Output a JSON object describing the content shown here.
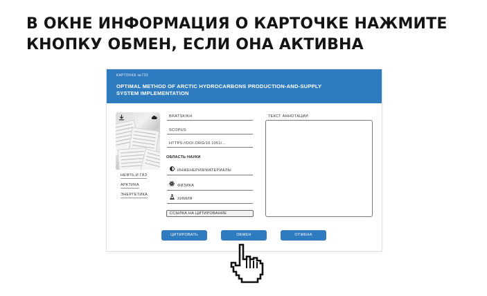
{
  "instruction": {
    "line1": "В ОКНЕ ИНФОРМАЦИЯ О КАРТОЧКЕ НАЖМИТЕ",
    "line2": "КНОПКУ ОБМЕН, ЕСЛИ ОНА АКТИВНА"
  },
  "card": {
    "number": "КАРТОЧКА №733",
    "title_line1": "OPTIMAL METHOD OF ARCTIC HYDROCARBONS PRODUCTION-AND-SUPPLY",
    "title_line2": "SYSTEM IMPLEMENTATION",
    "thumbnail": {
      "download_icon": "download-icon",
      "cloud_icon": "cloud-icon"
    },
    "tags": [
      "НЕФТЬ И ГАЗ",
      "АРКТИКА",
      "ЭНЕРГЕТИКА"
    ],
    "fields": {
      "author": "BRATSKIKH",
      "database": "SCOPUS",
      "doi": "HTTPS://DOI.ORG/10.1051/..."
    },
    "science_area_label": "ОБЛАСТЬ НАУКИ",
    "science_areas": [
      {
        "icon": "half-circle-icon",
        "label": "ИНЖЕНЕРИЯ/МАТЕРИАЛЫ"
      },
      {
        "icon": "atom-icon",
        "label": "ФИЗИКА"
      },
      {
        "icon": "flask-icon",
        "label": "ХИМИЯ"
      }
    ],
    "citation_link": "ССЫЛКА НА ЦИТИРОВАНИЕ",
    "annotation_label": "ТЕКСТ АННОТАЦИИ",
    "annotation_text": "",
    "buttons": {
      "cite": "ЦИТИРОВАТЬ",
      "exchange": "ОБМЕН",
      "cancel": "ОТМЕНА"
    }
  },
  "colors": {
    "accent": "#2e7bbf",
    "text": "#141414"
  },
  "cursor_icon": "hand-pointer-icon"
}
